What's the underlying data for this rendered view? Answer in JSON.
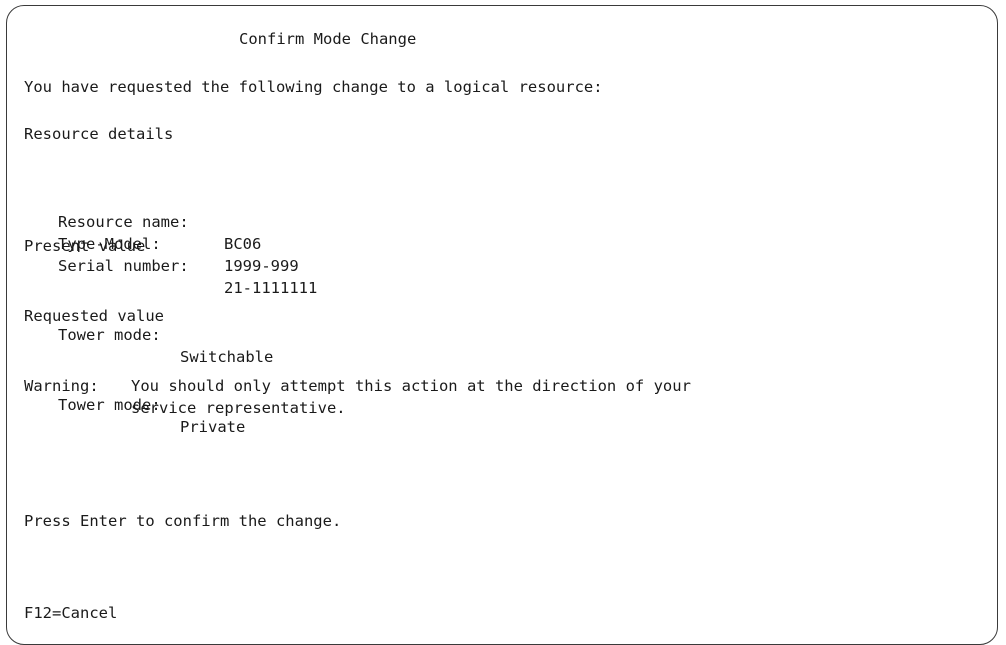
{
  "title": "Confirm Mode Change",
  "intro": "You have requested the following change to a logical resource:",
  "resource_details": {
    "heading": "Resource details",
    "fields": [
      {
        "label": "Resource name:",
        "value": "BC06"
      },
      {
        "label": "Type-Model:",
        "value": "1999-999"
      },
      {
        "label": "Serial number:",
        "value": "21-1111111"
      }
    ]
  },
  "present_value": {
    "heading": "Present value",
    "label": "Tower mode:",
    "value": "Switchable"
  },
  "requested_value": {
    "heading": "Requested value",
    "label": "Tower mode:",
    "value": "Private"
  },
  "warning": {
    "label": "Warning:",
    "line1": "You should only attempt this action at the direction of your",
    "line2": "service representative."
  },
  "prompt": "Press Enter to confirm the change.",
  "function_keys": [
    {
      "label": "F12=Cancel"
    }
  ]
}
